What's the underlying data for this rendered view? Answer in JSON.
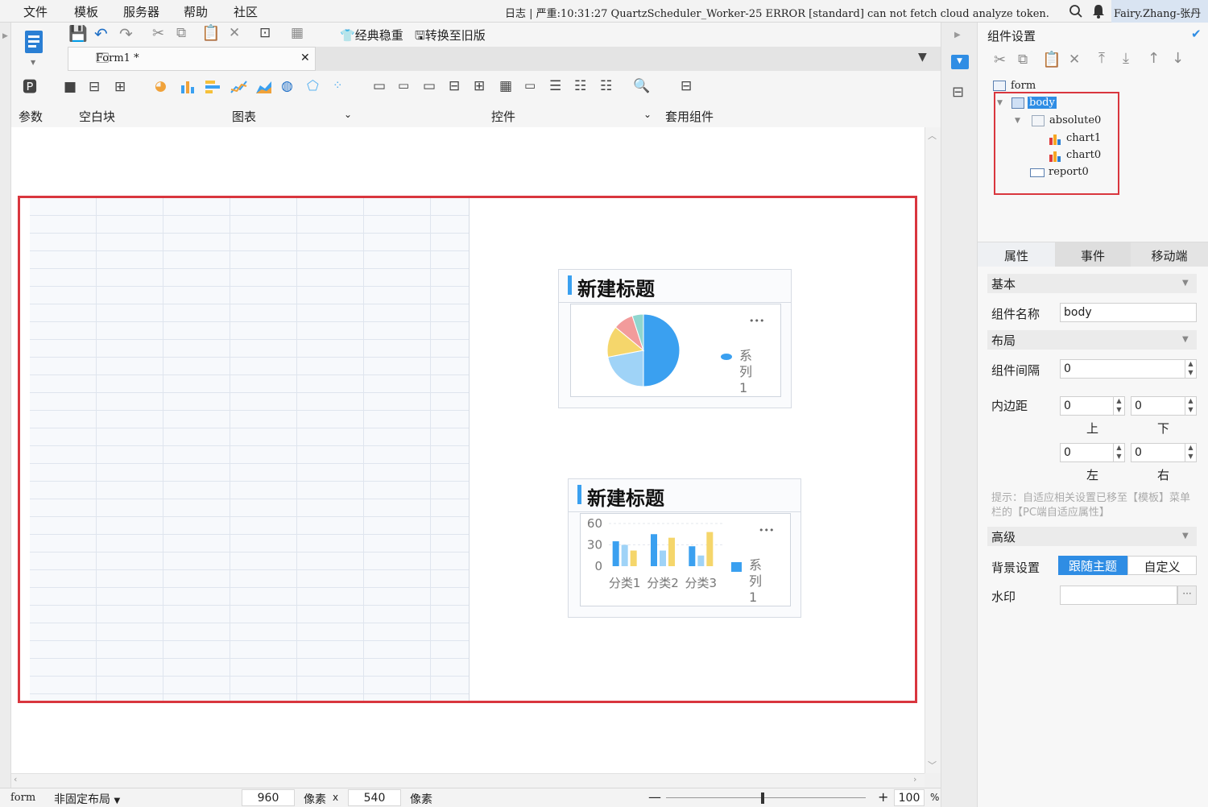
{
  "menubar": {
    "items": [
      "文件",
      "模板",
      "服务器",
      "帮助",
      "社区"
    ],
    "log_text": "日志 | 严重:10:31:27 QuartzScheduler_Worker-25 ERROR [standard] can not fetch cloud analyze token.",
    "user": "Fairy.Zhang-张丹"
  },
  "toolbar": {
    "classic_btn": "经典稳重",
    "convert_btn": "转换至旧版",
    "file_tab": "Form1 *",
    "groups": {
      "params": "参数",
      "blank": "空白块",
      "chart": "图表",
      "controls": "控件",
      "set_component": "套用组件"
    }
  },
  "canvas": {
    "pie_widget": {
      "title": "新建标题",
      "legend": "系列1",
      "more": "•••"
    },
    "bar_widget": {
      "title": "新建标题",
      "legend": "系列1",
      "more": "•••",
      "categories": [
        "分类1",
        "分类2",
        "分类3"
      ],
      "y_ticks": [
        "60",
        "30",
        "0"
      ]
    }
  },
  "chart_data": [
    {
      "type": "pie",
      "title": "新建标题",
      "series": [
        {
          "name": "系列1",
          "values": [
            50,
            22,
            14,
            9,
            5
          ]
        }
      ],
      "colors": [
        "#3aa0f0",
        "#9fd3f7",
        "#f5d66b",
        "#f29b9b",
        "#8fd6cf"
      ]
    },
    {
      "type": "bar",
      "title": "新建标题",
      "categories": [
        "分类1",
        "分类2",
        "分类3"
      ],
      "series": [
        {
          "name": "系列1",
          "values": [
            35,
            45,
            28
          ]
        },
        {
          "values": [
            30,
            22,
            15
          ]
        },
        {
          "values": [
            22,
            40,
            48
          ]
        }
      ],
      "ylim": [
        0,
        60
      ],
      "colors": [
        "#3aa0f0",
        "#9fd3f7",
        "#f5d66b"
      ]
    }
  ],
  "status": {
    "layout_mode": "form",
    "layout_select": "非固定布局",
    "width": "960",
    "unit": "像素",
    "times": "x",
    "height": "540",
    "zoom": "100",
    "percent": "%"
  },
  "right_panel": {
    "title": "组件设置",
    "tree": [
      "form",
      "body",
      "absolute0",
      "chart1",
      "chart0",
      "report0"
    ],
    "tabs": [
      "属性",
      "事件",
      "移动端"
    ],
    "sections": {
      "basic": "基本",
      "layout": "布局",
      "advanced": "高级"
    },
    "labels": {
      "name": "组件名称",
      "gap": "组件间隔",
      "padding": "内边距",
      "top": "上",
      "bottom": "下",
      "left": "左",
      "right": "右",
      "bg": "背景设置",
      "watermark": "水印"
    },
    "values": {
      "name": "body",
      "gap": "0",
      "pad_top": "0",
      "pad_bottom": "0",
      "pad_left": "0",
      "pad_right": "0"
    },
    "hint": "提示：自适应相关设置已移至【模板】菜单栏的【PC端自适应属性】",
    "bg_options": [
      "跟随主题",
      "自定义"
    ],
    "watermark_btn": "···"
  },
  "colors": {
    "accent": "#1f6fc6",
    "highlight": "#d9363e",
    "selected": "#2f8de4"
  }
}
